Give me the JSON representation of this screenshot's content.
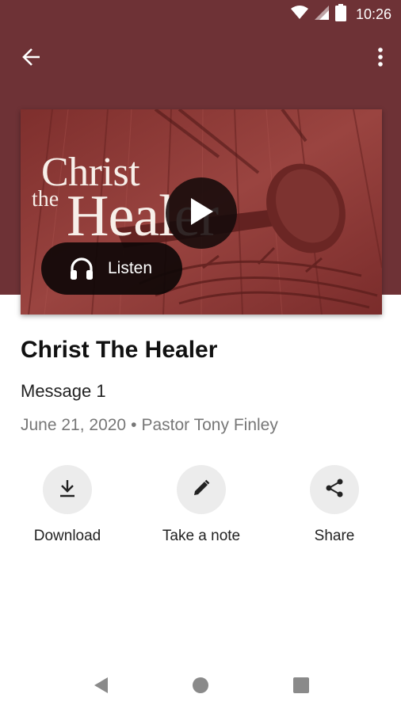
{
  "status_bar": {
    "time": "10:26",
    "icons": [
      "wifi-icon",
      "cell-signal-icon",
      "battery-icon"
    ]
  },
  "app_bar": {
    "back_icon": "arrow-back-icon",
    "menu_icon": "more-vert-icon"
  },
  "colors": {
    "header": "#6e3236",
    "hero_tint": "#8f3a37",
    "action_circle": "#ececec",
    "meta_text": "#777777"
  },
  "hero": {
    "artwork_title_line1": "Christ",
    "artwork_title_the": "the",
    "artwork_title_line2": "Healer",
    "play_icon": "play-icon",
    "listen_icon": "headphones-icon",
    "listen_label": "Listen"
  },
  "sermon": {
    "title": "Christ The Healer",
    "subtitle": "Message 1",
    "date": "June 21, 2020",
    "separator": "•",
    "speaker": "Pastor Tony Finley"
  },
  "actions": [
    {
      "label": "Download",
      "icon": "download-icon"
    },
    {
      "label": "Take a note",
      "icon": "pencil-icon"
    },
    {
      "label": "Share",
      "icon": "share-icon"
    }
  ],
  "nav_bar": {
    "icons": [
      "nav-back-icon",
      "nav-home-icon",
      "nav-recents-icon"
    ]
  }
}
